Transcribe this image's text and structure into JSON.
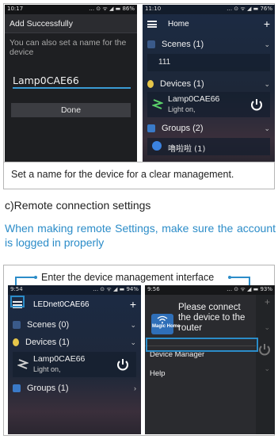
{
  "figure1": {
    "phone_dialog": {
      "status_time": "10:17",
      "status_right": "… ⊙ ᯤ ◢ ▬ 86%",
      "title": "Add Successfully",
      "message": "You can also set a name for the device",
      "input_value": "Lamp0CAE66",
      "done_label": "Done"
    },
    "phone_home": {
      "status_time": "11:10",
      "status_right": "… ⊙ ᯤ ◢ ▬ 76%",
      "title": "Home",
      "plus": "+",
      "scenes_label": "Scenes (1)",
      "scene_item": "111",
      "devices_label": "Devices (1)",
      "device_name": "Lamp0CAE66",
      "device_state": "Light on,",
      "groups_label": "Groups (2)",
      "group_item": "嚕啦啦 (1)"
    },
    "caption": "Set a name for the device for a clear management."
  },
  "section_title": "c)Remote connection settings",
  "note": "When making remote Settings, make sure the account is logged in properly",
  "figure2": {
    "label": "Enter the device management interface",
    "phone_home": {
      "status_time": "9:54",
      "status_right": "… ⊙ ᯤ ◢ ▬ 94%",
      "title": "LEDnet0CAE66",
      "plus": "+",
      "scenes_label": "Scenes (0)",
      "devices_label": "Devices (1)",
      "device_name": "Lamp0CAE66",
      "device_state": "Light on,",
      "groups_label": "Groups (1)"
    },
    "phone_drawer": {
      "status_time": "9:56",
      "status_right": "… ⊙ ᯤ ◢ ▬ 93%",
      "prompt": "Please connect the device to the router",
      "logo_text": "Magic Home",
      "menu_device_manager": "Device Manager",
      "menu_help": "Help"
    }
  },
  "colors": {
    "accent_blue": "#2b8cc8",
    "input_underline": "#3a9bd4"
  }
}
